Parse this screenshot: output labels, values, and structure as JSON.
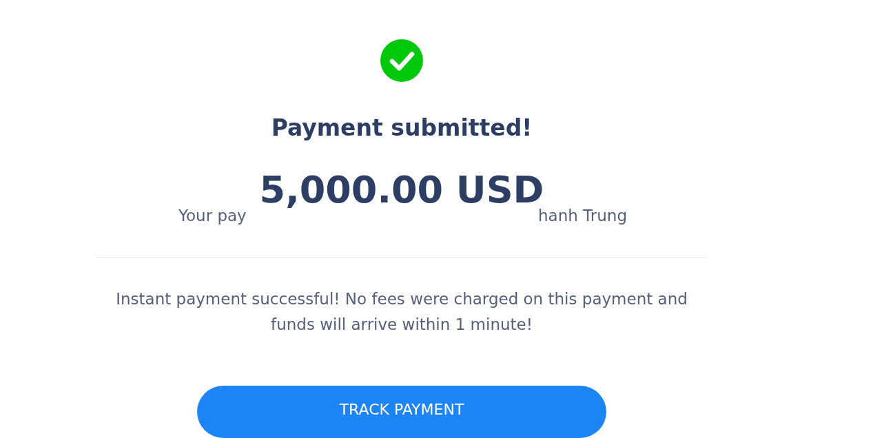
{
  "status": {
    "success": true
  },
  "title": "Payment submitted!",
  "amount": "5,000.00 USD",
  "recipient_fragments": [
    "Your pay",
    "hanh Trung"
  ],
  "message": "Instant payment successful! No fees were charged on this payment and funds will arrive within 1 minute!",
  "button": {
    "label": "TRACK PAYMENT"
  }
}
